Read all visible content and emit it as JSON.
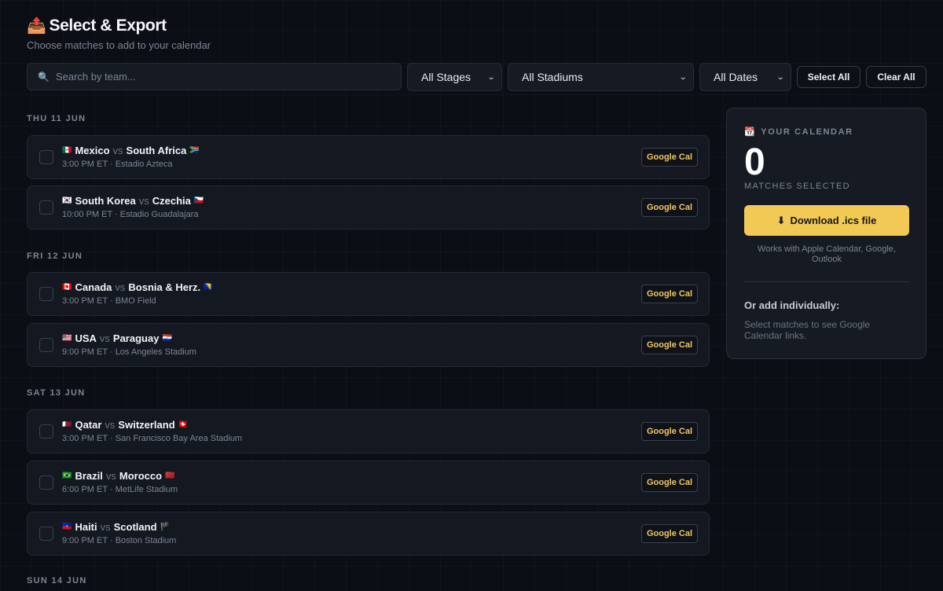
{
  "header": {
    "icon": "📤",
    "title": "Select & Export",
    "subtitle": "Choose matches to add to your calendar"
  },
  "toolbar": {
    "search_icon": "🔍",
    "search_placeholder": "Search by team...",
    "stages": "All Stages",
    "stadiums": "All Stadiums",
    "dates": "All Dates",
    "select_all": "Select All",
    "clear_all": "Clear All"
  },
  "days": [
    {
      "label": "THU 11 JUN",
      "matches": [
        {
          "home_flag": "🇲🇽",
          "home": "Mexico",
          "away": "South Africa",
          "away_flag": "🇿🇦",
          "time": "3:00 PM ET",
          "venue": "Estadio Azteca",
          "gcal": "Google Cal"
        },
        {
          "home_flag": "🇰🇷",
          "home": "South Korea",
          "away": "Czechia",
          "away_flag": "🇨🇿",
          "time": "10:00 PM ET",
          "venue": "Estadio Guadalajara",
          "gcal": "Google Cal"
        }
      ]
    },
    {
      "label": "FRI 12 JUN",
      "matches": [
        {
          "home_flag": "🇨🇦",
          "home": "Canada",
          "away": "Bosnia & Herz.",
          "away_flag": "🇧🇦",
          "time": "3:00 PM ET",
          "venue": "BMO Field",
          "gcal": "Google Cal"
        },
        {
          "home_flag": "🇺🇸",
          "home": "USA",
          "away": "Paraguay",
          "away_flag": "🇵🇾",
          "time": "9:00 PM ET",
          "venue": "Los Angeles Stadium",
          "gcal": "Google Cal"
        }
      ]
    },
    {
      "label": "SAT 13 JUN",
      "matches": [
        {
          "home_flag": "🇶🇦",
          "home": "Qatar",
          "away": "Switzerland",
          "away_flag": "🇨🇭",
          "time": "3:00 PM ET",
          "venue": "San Francisco Bay Area Stadium",
          "gcal": "Google Cal"
        },
        {
          "home_flag": "🇧🇷",
          "home": "Brazil",
          "away": "Morocco",
          "away_flag": "🇲🇦",
          "time": "6:00 PM ET",
          "venue": "MetLife Stadium",
          "gcal": "Google Cal"
        },
        {
          "home_flag": "🇭🇹",
          "home": "Haiti",
          "away": "Scotland",
          "away_flag": "🏴",
          "time": "9:00 PM ET",
          "venue": "Boston Stadium",
          "gcal": "Google Cal"
        }
      ]
    },
    {
      "label": "SUN 14 JUN",
      "matches": []
    }
  ],
  "vs_text": "vs",
  "meta_separator": "·",
  "calendar_panel": {
    "icon": "📆",
    "title": "YOUR CALENDAR",
    "count": "0",
    "count_label": "MATCHES SELECTED",
    "download_icon": "⬇",
    "download_label": "Download .ics file",
    "works_with": "Works with Apple Calendar, Google, Outlook",
    "or_add": "Or add individually:",
    "hint": "Select matches to see Google Calendar links."
  },
  "colors": {
    "background": "#0b0e14",
    "card": "#141821",
    "accent": "#f2c955",
    "muted": "#7d8595"
  }
}
